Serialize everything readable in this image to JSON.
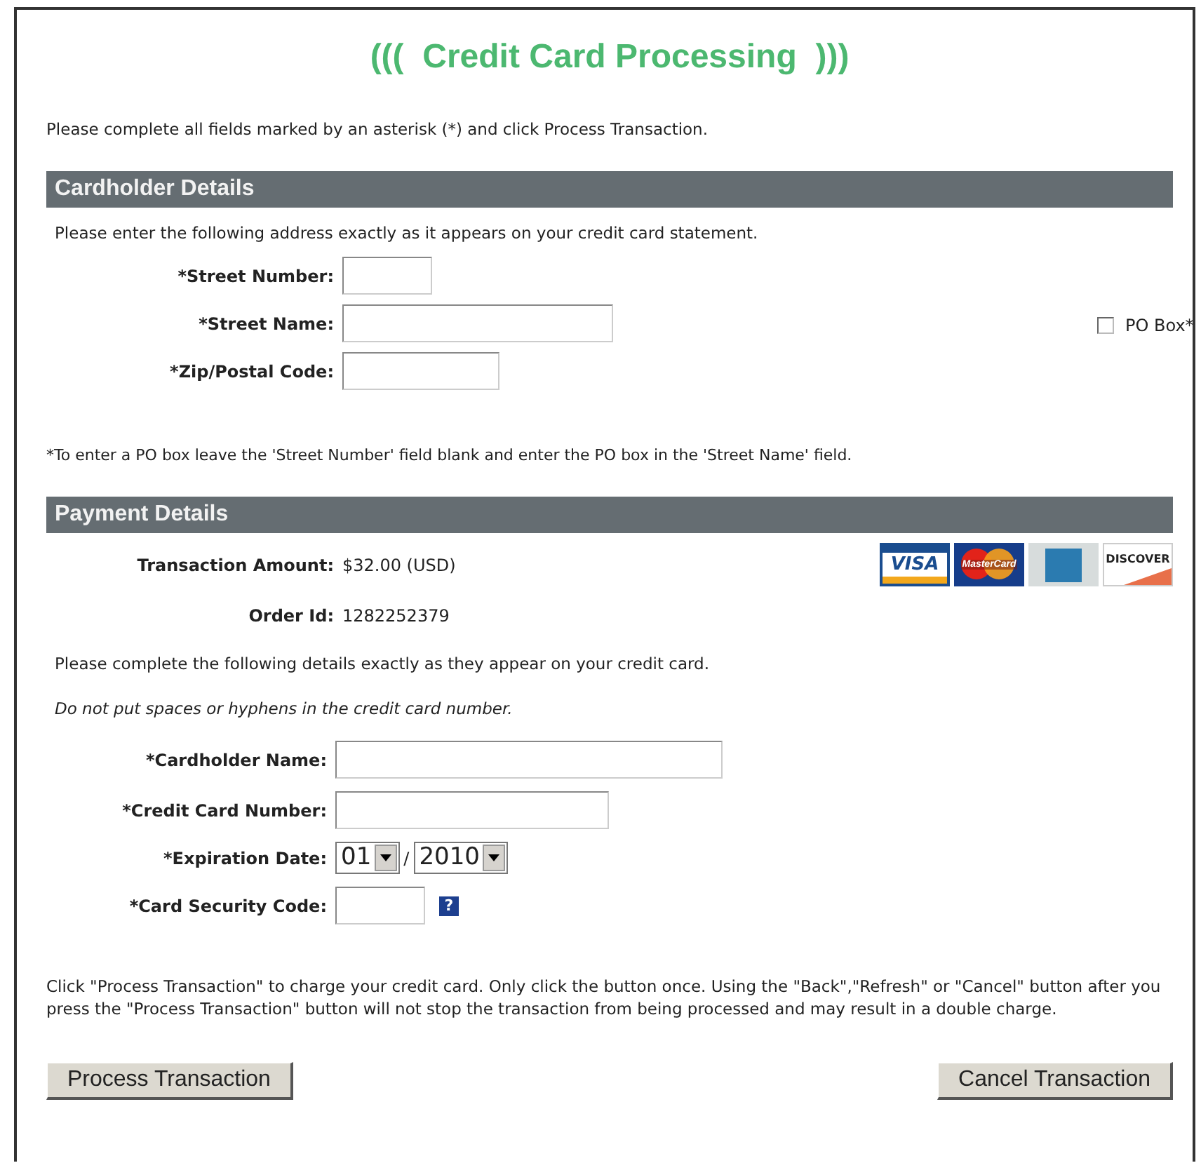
{
  "title": "(((  Credit Card Processing  )))",
  "intro": "Please complete all fields marked by an asterisk (*) and click Process Transaction.",
  "cardholder": {
    "heading": "Cardholder Details",
    "instruction": "Please enter the following address exactly as it appears on your credit card statement.",
    "fields": [
      {
        "label": "*Street Number:"
      },
      {
        "label": "*Street Name:"
      },
      {
        "label": "*Zip/Postal Code:"
      }
    ],
    "po_box": {
      "label": "PO Box*",
      "checked": false
    },
    "note": "*To enter a PO box leave the 'Street Number' field blank and enter the PO box in the 'Street Name' field."
  },
  "payment": {
    "heading": "Payment Details",
    "info": [
      {
        "label": "Transaction Amount:",
        "value": "$32.00 (USD)"
      },
      {
        "label": "Order Id:",
        "value": "1282252379"
      }
    ],
    "card_logos": [
      {
        "kind": "visa",
        "text": "VISA"
      },
      {
        "kind": "mastercard",
        "text": "MasterCard"
      },
      {
        "kind": "amex"
      },
      {
        "kind": "discover",
        "text": "DISCOVER"
      }
    ],
    "instruction": "Please complete the following details exactly as they appear on your credit card.",
    "hint": "Do not put spaces or hyphens in the credit card number.",
    "fields": [
      {
        "kind": "text",
        "label": "*Cardholder Name:"
      },
      {
        "kind": "text",
        "label": "*Credit Card Number:"
      },
      {
        "kind": "date",
        "label": "*Expiration Date:",
        "month": "01",
        "separator": "/",
        "year": "2010"
      },
      {
        "kind": "code",
        "label": "*Card Security Code:",
        "help": "?"
      }
    ]
  },
  "warning": "Click \"Process Transaction\" to charge your credit card. Only click the button once. Using the \"Back\",\"Refresh\" or \"Cancel\" button after you press the \"Process Transaction\" button will not stop the transaction from being processed and may result in a double charge.",
  "buttons": [
    "Process Transaction",
    "Cancel Transaction"
  ]
}
